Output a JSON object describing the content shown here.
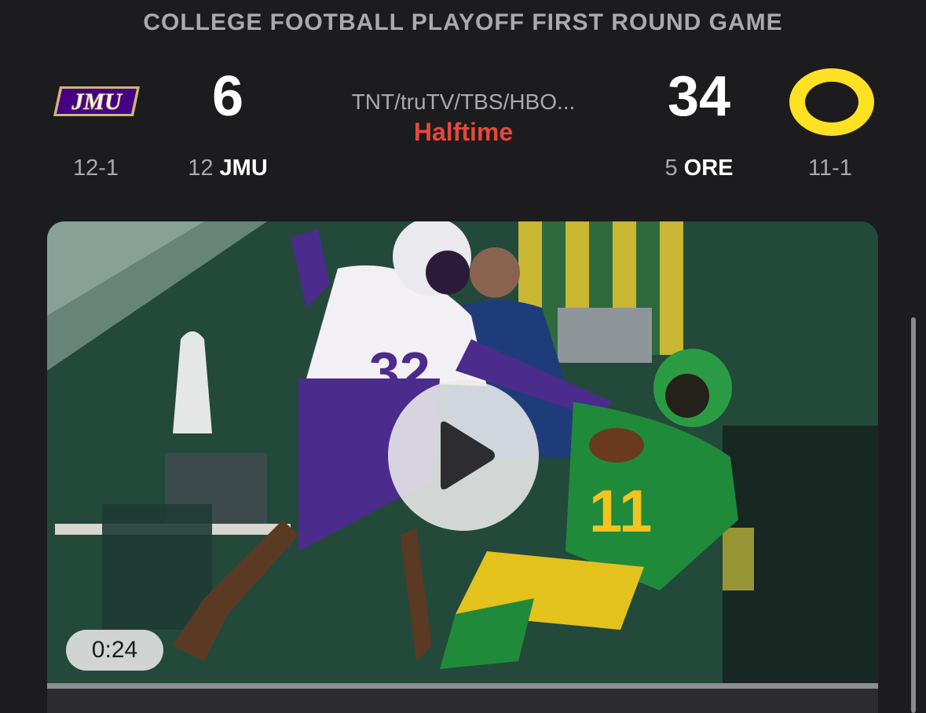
{
  "header": {
    "title": "COLLEGE FOOTBALL PLAYOFF FIRST ROUND GAME"
  },
  "away": {
    "logo_text": "JMU",
    "score": "6",
    "record": "12-1",
    "rank": "12",
    "abbr": "JMU",
    "logo_color": "#450084",
    "logo_accent": "#cbb677"
  },
  "home": {
    "logo_text": "O",
    "score": "34",
    "record": "11-1",
    "rank": "5",
    "abbr": "ORE",
    "logo_color": "#fee123"
  },
  "broadcast": "TNT/truTV/TBS/HBO...",
  "status": "Halftime",
  "video": {
    "duration": "0:24",
    "play_icon": "play-icon",
    "thumbnail_icon": "game-highlight-thumbnail"
  },
  "colors": {
    "background": "#1c1c1e",
    "status": "#e5483a",
    "muted_text": "#a9a9ae"
  }
}
